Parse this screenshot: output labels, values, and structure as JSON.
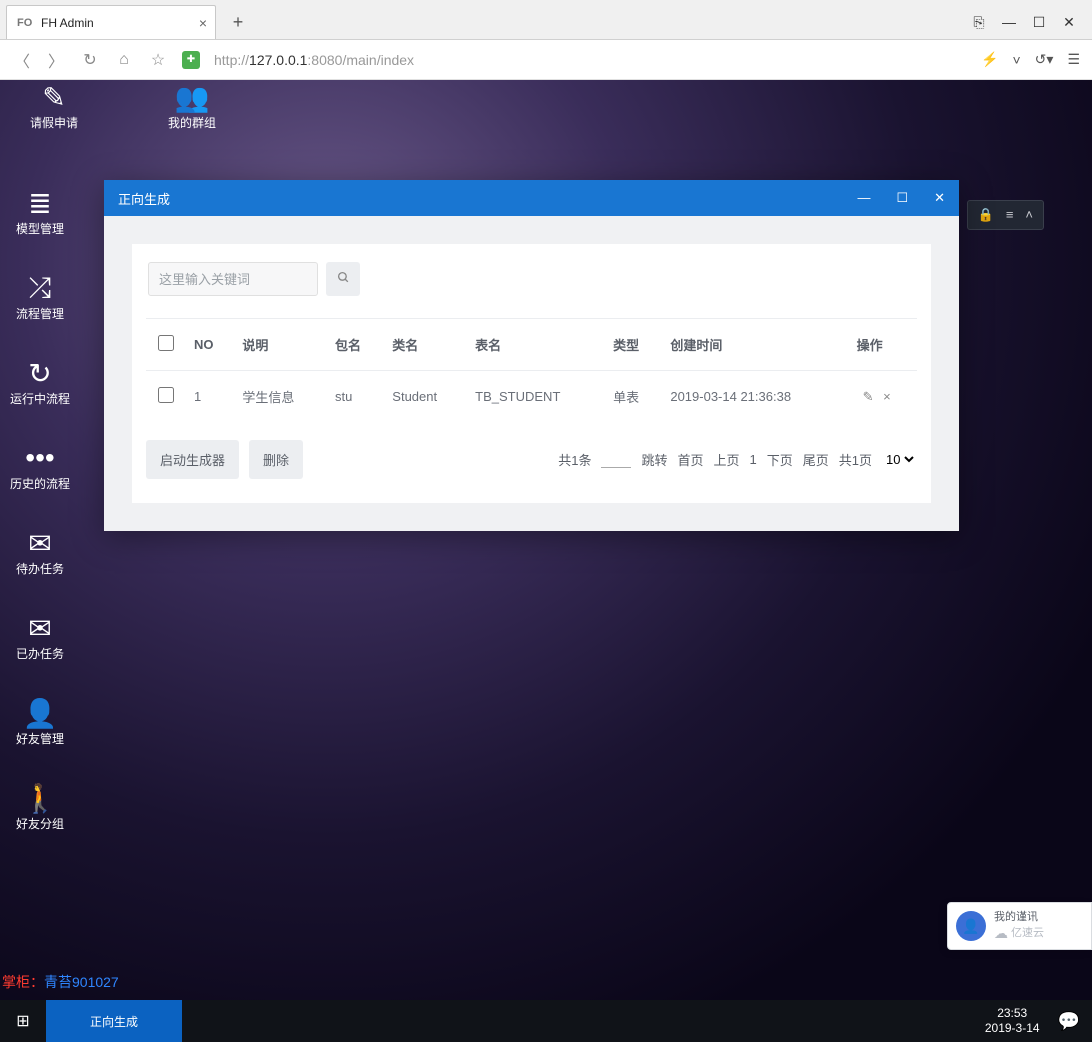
{
  "browser": {
    "tab_title": "FH Admin",
    "url_prefix": "http://",
    "url_host": "127.0.0.1",
    "url_port_path": ":8080/main/index"
  },
  "top_icons": [
    {
      "glyph": "✎",
      "label": "请假申请"
    },
    {
      "glyph": "👥",
      "label": "我的群组"
    }
  ],
  "sidebar": [
    {
      "glyph": "≣",
      "label": "模型管理"
    },
    {
      "glyph": "⤮",
      "label": "流程管理"
    },
    {
      "glyph": "↻",
      "label": "运行中流程"
    },
    {
      "glyph": "•••",
      "label": "历史的流程"
    },
    {
      "glyph": "✉",
      "label": "待办任务"
    },
    {
      "glyph": "✉",
      "label": "已办任务"
    },
    {
      "glyph": "👤",
      "label": "好友管理"
    },
    {
      "glyph": "🚶",
      "label": "好友分组"
    }
  ],
  "modal": {
    "title": "正向生成",
    "search_placeholder": "这里输入关键词",
    "columns": [
      "NO",
      "说明",
      "包名",
      "类名",
      "表名",
      "类型",
      "创建时间",
      "操作"
    ],
    "rows": [
      {
        "no": "1",
        "desc": "学生信息",
        "pkg": "stu",
        "cls": "Student",
        "tbl": "TB_STUDENT",
        "type": "单表",
        "created": "2019-03-14 21:36:38"
      }
    ],
    "btn_generate": "启动生成器",
    "btn_delete": "删除",
    "pager": {
      "total": "共1条",
      "jump": "跳转",
      "first": "首页",
      "prev": "上页",
      "cur": "1",
      "next": "下页",
      "last": "尾页",
      "pages": "共1页",
      "size": "10"
    }
  },
  "watermark": {
    "label": "掌柜：",
    "value": "青苔901027"
  },
  "taskbar": {
    "active": "正向生成",
    "time": "23:53",
    "date": "2019-3-14"
  },
  "helper": {
    "line1": "我的谨讯",
    "brand": "亿速云"
  }
}
